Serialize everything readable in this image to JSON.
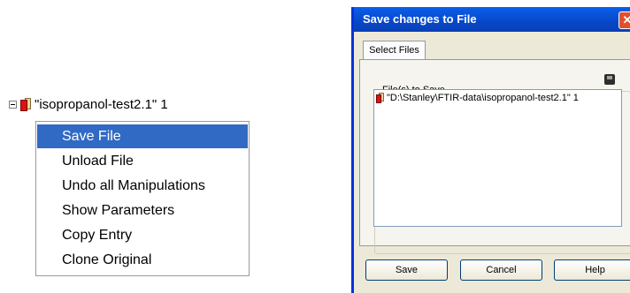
{
  "tree": {
    "node_label": "\"isopropanol-test2.1\" 1"
  },
  "context_menu": {
    "items": [
      {
        "label": "Save File",
        "selected": true
      },
      {
        "label": "Unload File"
      },
      {
        "label": "Undo all Manipulations"
      },
      {
        "label": "Show Parameters"
      },
      {
        "label": "Copy Entry"
      },
      {
        "label": "Clone Original"
      }
    ]
  },
  "dialog": {
    "title": "Save changes to File",
    "close_glyph": "✕",
    "tab_label": "Select Files",
    "group_label": "File(s) to Save",
    "file_list": [
      "\"D:\\Stanley\\FTIR-data\\isopropanol-test2.1\" 1"
    ],
    "buttons": {
      "save": "Save",
      "cancel": "Cancel",
      "help": "Help"
    }
  },
  "colors": {
    "selection": "#316ac5",
    "title_bar": "#0847c8",
    "dialog_face": "#ece9d8"
  },
  "icons": {
    "expander": "minus-box-icon",
    "file": "file-icon",
    "save": "disk-icon"
  }
}
